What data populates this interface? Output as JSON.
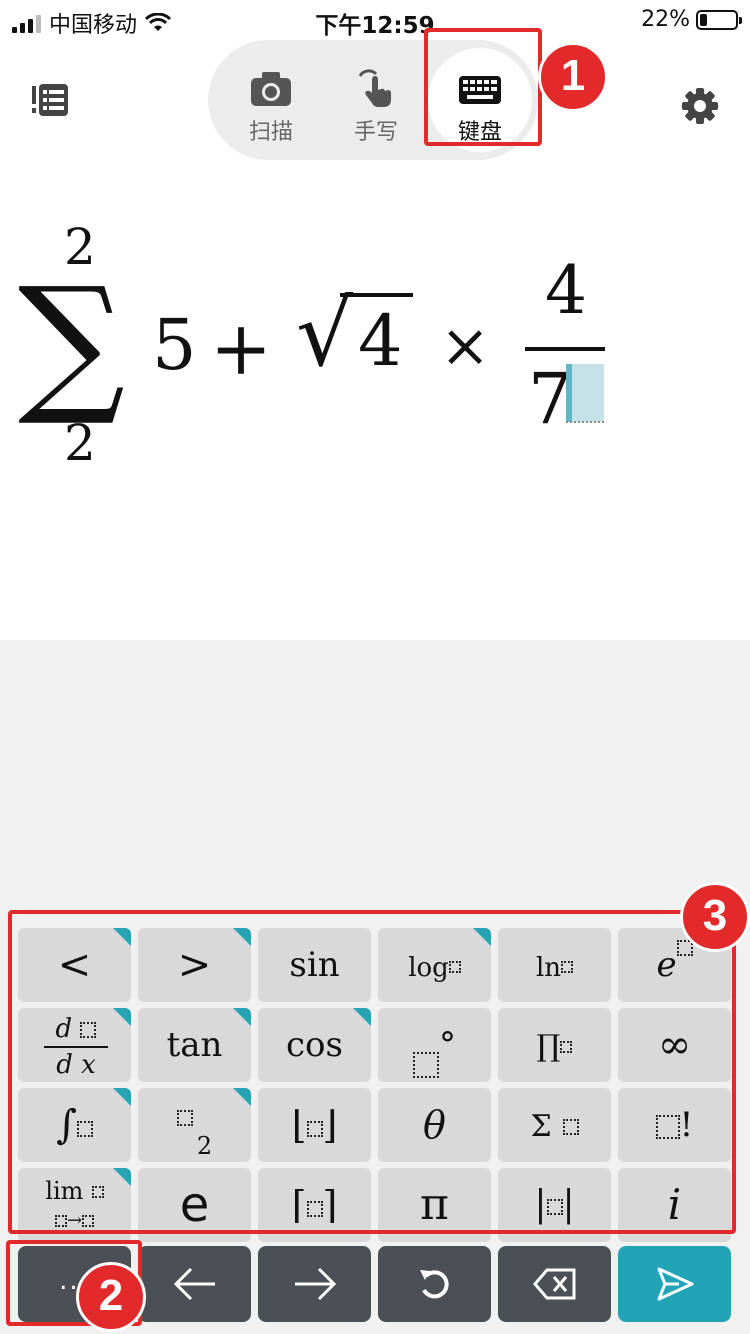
{
  "status_bar": {
    "carrier": "中国移动",
    "time": "下午12:59",
    "battery": "22%",
    "battery_level": 0.22
  },
  "header": {
    "modes": [
      {
        "label": "扫描",
        "icon": "camera-icon"
      },
      {
        "label": "手写",
        "icon": "hand-pointer-icon"
      },
      {
        "label": "键盘",
        "icon": "keyboard-icon",
        "selected": true
      }
    ],
    "left_icon": "list-icon",
    "right_icon": "gear-icon"
  },
  "annotations": [
    "1",
    "2",
    "3"
  ],
  "expression": {
    "sum_upper": "2",
    "sum_lower": "2",
    "sum_symbol": "∑",
    "term1": "5",
    "plus": "+",
    "sqrt_symbol": "√",
    "radicand": "4",
    "times": "×",
    "numerator": "4",
    "denominator": "7"
  },
  "keyboard": {
    "keys": {
      "lt": "<",
      "gt": ">",
      "sin": "sin",
      "log": "log",
      "ln": "ln",
      "e_base": "e",
      "d_top": "d",
      "d_bot": "d x",
      "tan": "tan",
      "cos": "cos",
      "degree": "°",
      "prod": "∏",
      "infinity": "∞",
      "integral": "∫",
      "sub_digit": "2",
      "theta": "θ",
      "sigma": "Σ",
      "factorial": "!",
      "lim": "lim",
      "arrow": "→",
      "euler": "e",
      "pi": "π",
      "imaginary": "i"
    },
    "accent_color": "#28a3b4",
    "actions": [
      {
        "name": "more",
        "label": "..."
      },
      {
        "name": "left-arrow",
        "icon": "arrow-left-icon"
      },
      {
        "name": "right-arrow",
        "icon": "arrow-right-icon"
      },
      {
        "name": "undo",
        "icon": "undo-icon"
      },
      {
        "name": "backspace",
        "icon": "backspace-icon"
      },
      {
        "name": "submit",
        "icon": "send-icon"
      }
    ]
  }
}
